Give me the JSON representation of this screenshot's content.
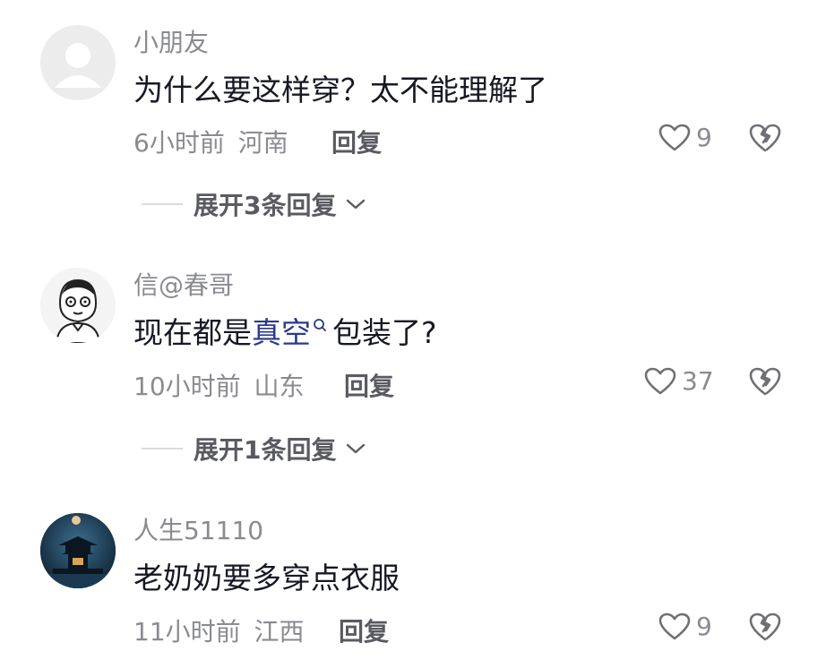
{
  "comments": [
    {
      "username": "小朋友",
      "text": "为什么要这样穿？太不能理解了",
      "time": "6小时前",
      "location": "河南",
      "reply_label": "回复",
      "likes": "9",
      "expand_label": "展开3条回复"
    },
    {
      "username": "信@春哥",
      "text_before": "现在都是",
      "text_link": "真空",
      "text_after": "包装了?",
      "time": "10小时前",
      "location": "山东",
      "reply_label": "回复",
      "likes": "37",
      "expand_label": "展开1条回复"
    },
    {
      "username": "人生51110",
      "text": "老奶奶要多穿点衣服",
      "time": "11小时前",
      "location": "江西",
      "reply_label": "回复",
      "likes": "9"
    }
  ],
  "colors": {
    "text_primary": "#161823",
    "text_secondary": "#8a8b91",
    "link": "#2a3a8c"
  },
  "icons": [
    "heart-outline-icon",
    "broken-heart-icon",
    "chevron-down-icon",
    "search-mini-icon"
  ]
}
